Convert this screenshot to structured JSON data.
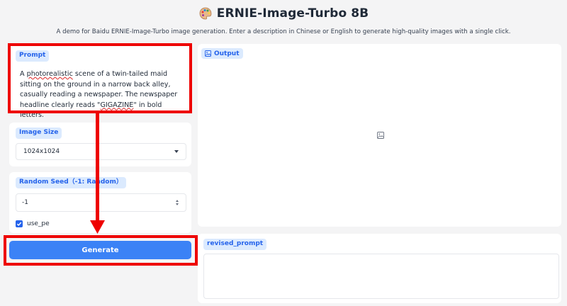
{
  "header": {
    "icon": "palette-icon",
    "title": "ERNIE-Image-Turbo 8B",
    "subtitle": "A demo for Baidu ERNIE-Image-Turbo image generation. Enter a description in Chinese or English to generate high-quality images with a single click."
  },
  "prompt": {
    "label": "Prompt",
    "text_parts": [
      "A ",
      "photorealistic",
      " scene of a twin-tailed maid sitting on the ground in a narrow back alley, casually reading a newspaper. The newspaper headline clearly reads \"",
      "GIGAZINE",
      "\" in bold letters."
    ]
  },
  "image_size": {
    "label": "Image Size",
    "selected": "1024x1024"
  },
  "random_seed": {
    "label": "Random Seed（-1: Random）",
    "value": "-1"
  },
  "use_pe": {
    "label": "use_pe",
    "checked": true
  },
  "generate": {
    "label": "Generate"
  },
  "output": {
    "label": "Output",
    "icon": "image-icon"
  },
  "revised_prompt": {
    "label": "revised_prompt",
    "value": ""
  },
  "colors": {
    "accent": "#3b82f6",
    "chip_bg": "#dbeafe",
    "chip_text": "#2563eb",
    "annotation_red": "#ee0000",
    "background": "#f4f4f5"
  }
}
